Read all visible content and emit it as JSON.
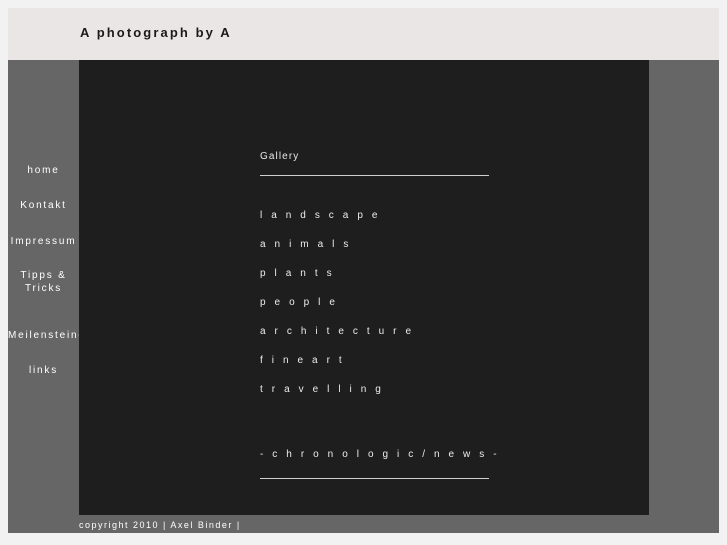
{
  "header": {
    "title": "A photograph by A",
    "background_color": "#eae6e6"
  },
  "sidebar": {
    "background_color": "#666666",
    "items": [
      {
        "label": "home"
      },
      {
        "label": "Kontakt"
      },
      {
        "label": "Impressum"
      },
      {
        "label": "Tipps & Tricks"
      },
      {
        "label": "Meilensteine"
      },
      {
        "label": "links"
      }
    ]
  },
  "content": {
    "background_color": "#1e1e1e",
    "gallery_heading": "Gallery",
    "categories": [
      {
        "label": "l a n d s c a p e"
      },
      {
        "label": "a n i m a l s"
      },
      {
        "label": "p l a n t s"
      },
      {
        "label": "p e o p l e"
      },
      {
        "label": "a r c h i t e c t u r e"
      },
      {
        "label": "f i n e a r t"
      },
      {
        "label": "t r a v e l l i n g"
      }
    ],
    "chronologic_link": "- c h r o n o l o g i c  /  n e w s -"
  },
  "footer": {
    "copyright": "copyright 2010 | Axel Binder |"
  }
}
